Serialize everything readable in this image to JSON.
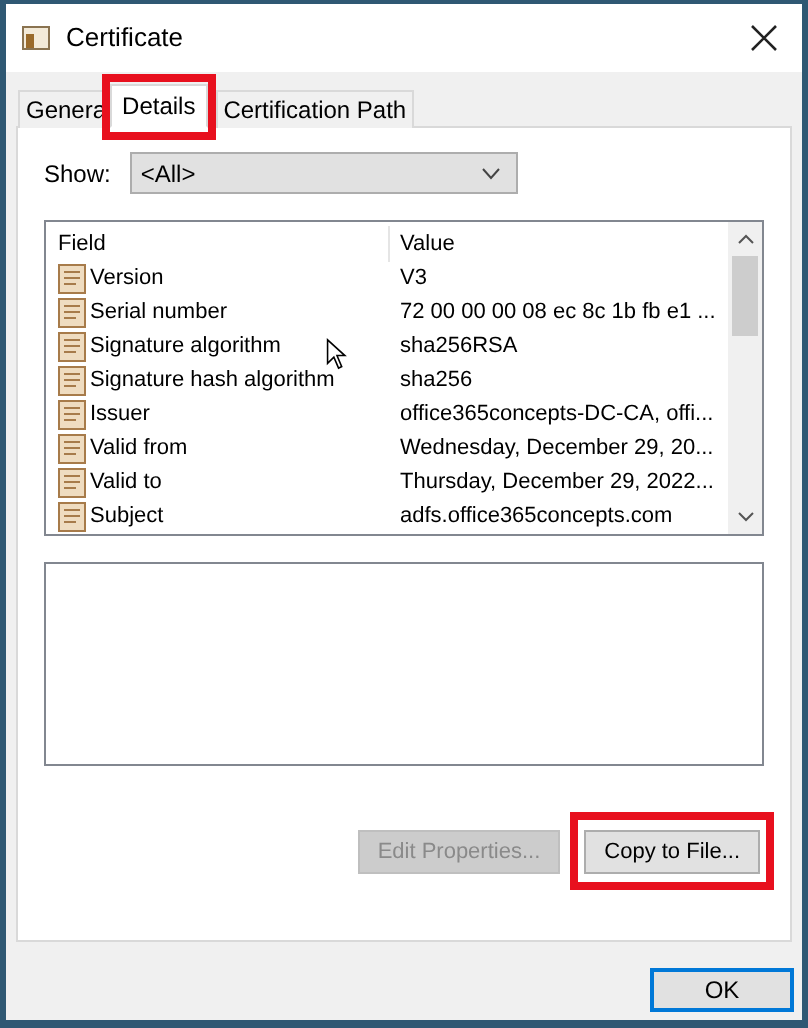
{
  "window": {
    "title": "Certificate"
  },
  "tabs": [
    {
      "label": "Genera",
      "selected": false,
      "highlighted": false
    },
    {
      "label": "Details",
      "selected": true,
      "highlighted": true
    },
    {
      "label": "Certification Path",
      "selected": false,
      "highlighted": false
    }
  ],
  "show": {
    "label": "Show:",
    "value": "<All>"
  },
  "table": {
    "columns": [
      "Field",
      "Value"
    ],
    "rows": [
      {
        "field": "Version",
        "value": "V3"
      },
      {
        "field": "Serial number",
        "value": "72 00 00 00 08 ec 8c 1b fb e1 ..."
      },
      {
        "field": "Signature algorithm",
        "value": "sha256RSA"
      },
      {
        "field": "Signature hash algorithm",
        "value": "sha256"
      },
      {
        "field": "Issuer",
        "value": "office365concepts-DC-CA, offi..."
      },
      {
        "field": "Valid from",
        "value": "Wednesday, December 29, 20..."
      },
      {
        "field": "Valid to",
        "value": "Thursday, December 29, 2022..."
      },
      {
        "field": "Subject",
        "value": "adfs.office365concepts.com"
      }
    ]
  },
  "buttons": [
    {
      "label": "Edit Properties...",
      "disabled": true,
      "highlighted": false
    },
    {
      "label": "Copy to File...",
      "disabled": false,
      "highlighted": true
    }
  ],
  "ok_button": {
    "label": "OK"
  }
}
